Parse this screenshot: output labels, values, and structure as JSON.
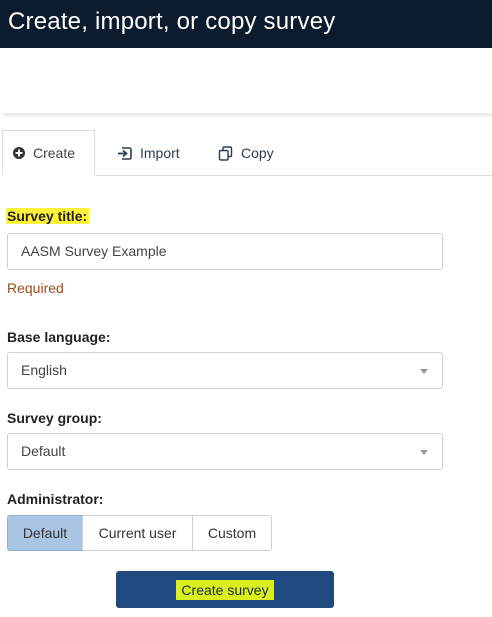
{
  "header": {
    "title": "Create, import, or copy survey",
    "background": "#0d1b2e"
  },
  "tabs": [
    {
      "label": "Create",
      "icon": "plus-circle-icon",
      "active": true
    },
    {
      "label": "Import",
      "icon": "import-arrow-icon",
      "active": false
    },
    {
      "label": "Copy",
      "icon": "copy-icon",
      "active": false
    }
  ],
  "form": {
    "survey_title": {
      "label": "Survey title:",
      "value": "AASM Survey Example",
      "validation": "Required"
    },
    "base_language": {
      "label": "Base language:",
      "selected": "English"
    },
    "survey_group": {
      "label": "Survey group:",
      "selected": "Default"
    },
    "administrator": {
      "label": "Administrator:",
      "options": [
        "Default",
        "Current user",
        "Custom"
      ],
      "selected": "Default"
    },
    "submit_label": "Create survey"
  },
  "colors": {
    "highlight": "#fff23a",
    "primary_button": "#1f4a80",
    "selected_segment": "#a8c6e4",
    "required_text": "#9a4a1c"
  }
}
